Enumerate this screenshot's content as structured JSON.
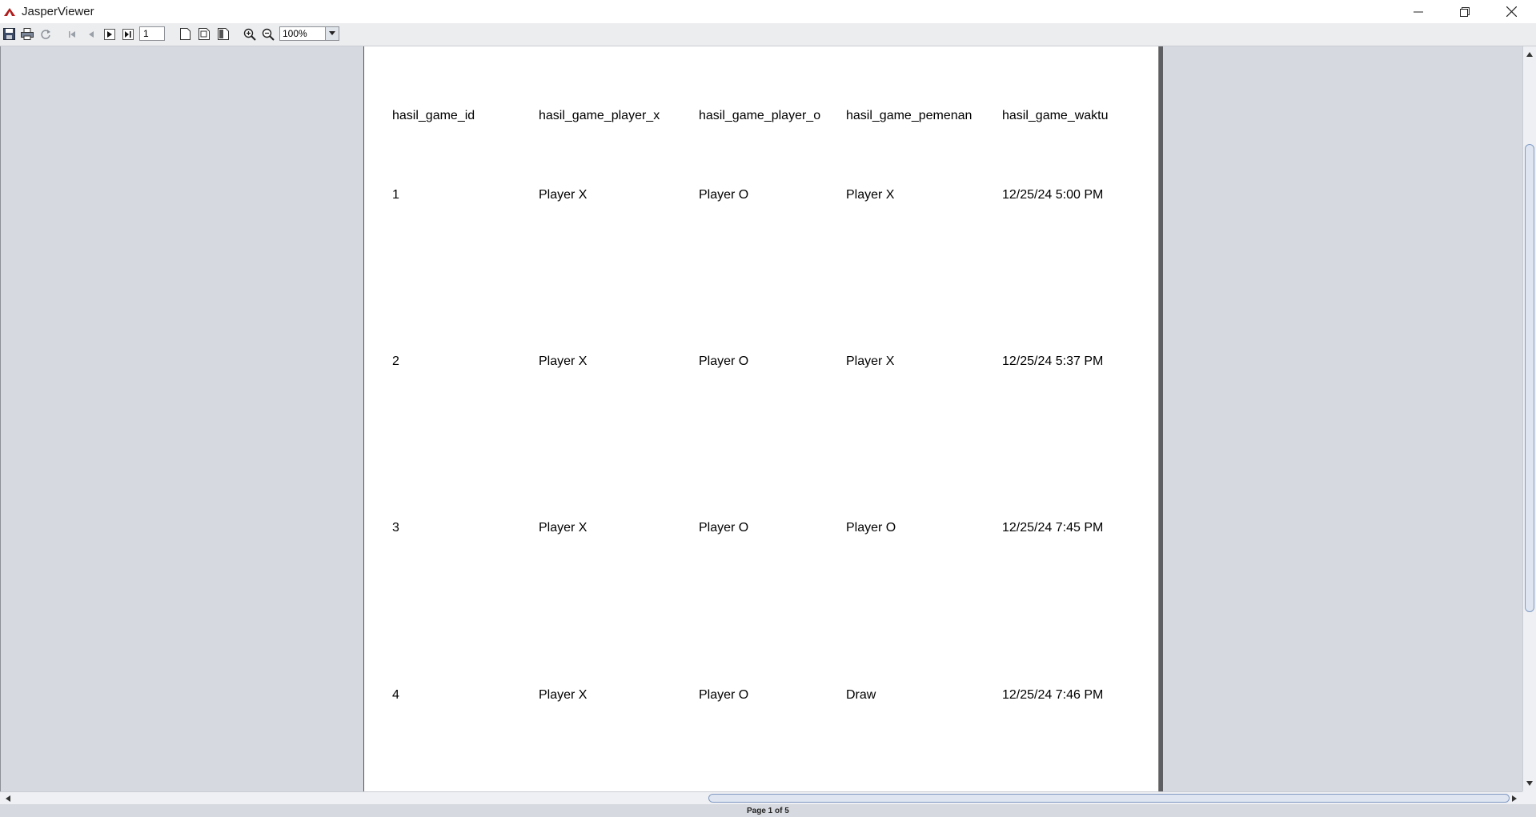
{
  "window": {
    "title": "JasperViewer",
    "icons": {
      "app": "jasper-triangle-icon",
      "minimize": "minimize-icon",
      "restore": "restore-icon",
      "close": "close-icon"
    }
  },
  "toolbar": {
    "buttons": [
      {
        "name": "save-icon"
      },
      {
        "name": "print-icon"
      },
      {
        "name": "reload-icon"
      },
      {
        "name": "first-page-icon"
      },
      {
        "name": "previous-page-icon"
      },
      {
        "name": "next-page-icon"
      },
      {
        "name": "last-page-icon"
      },
      {
        "name": "actual-size-icon"
      },
      {
        "name": "fit-page-icon"
      },
      {
        "name": "fit-width-icon"
      },
      {
        "name": "zoom-in-icon"
      },
      {
        "name": "zoom-out-icon"
      }
    ],
    "page_number": "1",
    "zoom_value": "100%"
  },
  "report": {
    "headers": [
      "hasil_game_id",
      "hasil_game_player_x",
      "hasil_game_player_o",
      "hasil_game_pemenan",
      "hasil_game_waktu"
    ],
    "rows": [
      [
        "1",
        "Player X",
        "Player O",
        "Player X",
        "12/25/24 5:00 PM"
      ],
      [
        "2",
        "Player X",
        "Player O",
        "Player X",
        "12/25/24 5:37 PM"
      ],
      [
        "3",
        "Player X",
        "Player O",
        "Player O",
        "12/25/24 7:45 PM"
      ],
      [
        "4",
        "Player X",
        "Player O",
        "Draw",
        "12/25/24 7:46 PM"
      ]
    ]
  },
  "status": {
    "page_label": "Page 1 of 5"
  }
}
